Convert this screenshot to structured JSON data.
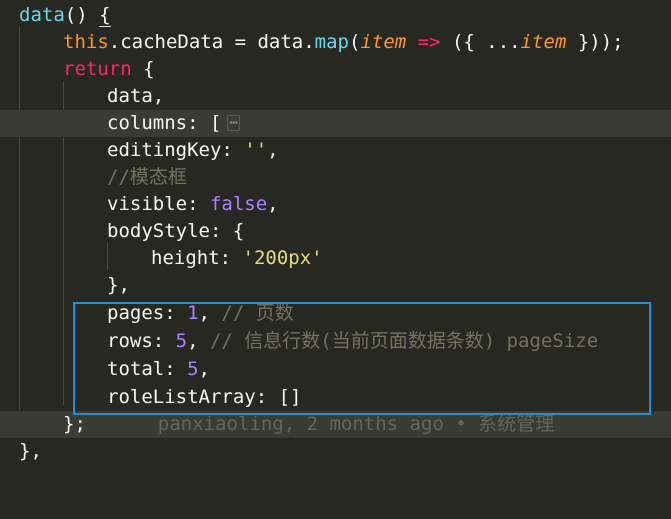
{
  "editor": {
    "lines": {
      "l1": {
        "fn": "data",
        "rest": "() ",
        "brace": "{"
      },
      "l2": {
        "this": "this",
        "prop": ".cacheData = data.",
        "map": "map",
        "open": "(",
        "param": "item",
        "arrow": " => ",
        "mid": "({ ...",
        "param2": "item",
        "close": " }));"
      },
      "l3": {
        "kw": "return",
        "rest": " {"
      },
      "l4": {
        "text": "data,"
      },
      "l5": {
        "text": "columns: [",
        "fold": "⋯"
      },
      "l6": {
        "key": "editingKey: ",
        "str": "''",
        "end": ","
      },
      "l7": {
        "comment": "//模态框"
      },
      "l8": {
        "key": "visible: ",
        "val": "false",
        "end": ","
      },
      "l9": {
        "text": "bodyStyle: {"
      },
      "l10": {
        "key": "height: ",
        "str": "'200px'"
      },
      "l11": {
        "text": "},"
      },
      "l12": {
        "key": "pages: ",
        "num": "1",
        "end": ", ",
        "comment": "// 页数"
      },
      "l13": {
        "key": "rows: ",
        "num": "5",
        "end": ", ",
        "comment": "// 信息行数(当前页面数据条数) pageSize"
      },
      "l14": {
        "key": "total: ",
        "num": "5",
        "end": ","
      },
      "l15": {
        "text": "roleListArray: []"
      },
      "l16": {
        "text": "};",
        "blame": "panxiaoling, 2 months ago • 系统管理"
      },
      "l17": {
        "text": "},"
      }
    }
  },
  "colors": {
    "background": "#272822",
    "keyword": "#f92672",
    "string": "#e6db74",
    "number": "#ae81ff",
    "comment": "#75715e",
    "highlight_box": "#1e90d8"
  }
}
